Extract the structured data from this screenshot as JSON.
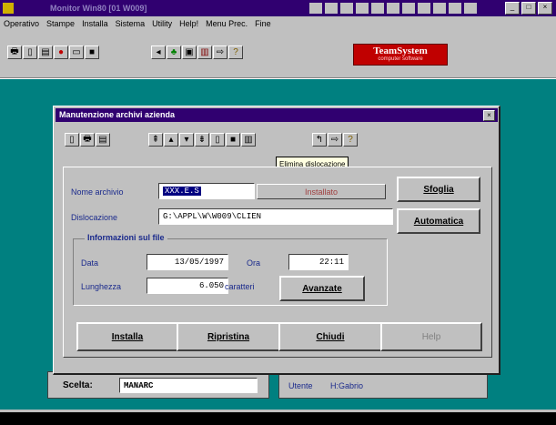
{
  "app": {
    "title": "Monitor    Win80 [01 W009]",
    "menu": [
      "Operativo",
      "Stampe",
      "Installa",
      "Sistema",
      "Utility",
      "Help!",
      "Menu Prec.",
      "Fine"
    ],
    "toolbar_icons": [
      "print-icon",
      "document-icon",
      "preview-icon",
      "stop-icon",
      "window-icon",
      "save-icon",
      "back-icon",
      "tree-icon",
      "folder-icon",
      "books-icon",
      "exit-icon",
      "help-icon"
    ],
    "logo": {
      "text": "TeamSystem",
      "sub": "computer software"
    }
  },
  "dialog": {
    "title": "Manutenzione archivi azienda",
    "tooltip": "Elimina dislocazione",
    "fields": {
      "nome_label": "Nome archivio",
      "nome_value": "XXX.E.S",
      "installato": "Installato",
      "dislocazione_label": "Dislocazione",
      "dislocazione_value": "G:\\APPL\\W\\W009\\CLIEN",
      "group_title": "Informazioni sul file",
      "data_label": "Data",
      "data_value": "13/05/1997",
      "ora_label": "Ora",
      "ora_value": "22:11",
      "lunghezza_label": "Lunghezza",
      "lunghezza_value": "6.050",
      "caratteri": "caratteri"
    },
    "buttons": {
      "sfoglia": "Sfoglia",
      "automatica": "Automatica",
      "avanzate": "Avanzate",
      "installa": "Installa",
      "ripristina": "Ripristina",
      "chiudi": "Chiudi",
      "help": "Help"
    }
  },
  "background": {
    "scelta_label": "Scelta:",
    "scelta_value": "MANARC",
    "utente_label": "Utente",
    "utente_value": "H:Gabrio"
  },
  "colors": {
    "teal": "#008080",
    "title_purple": "#300070",
    "title_bar": "#000080",
    "label_blue": "#1a2a8c"
  }
}
